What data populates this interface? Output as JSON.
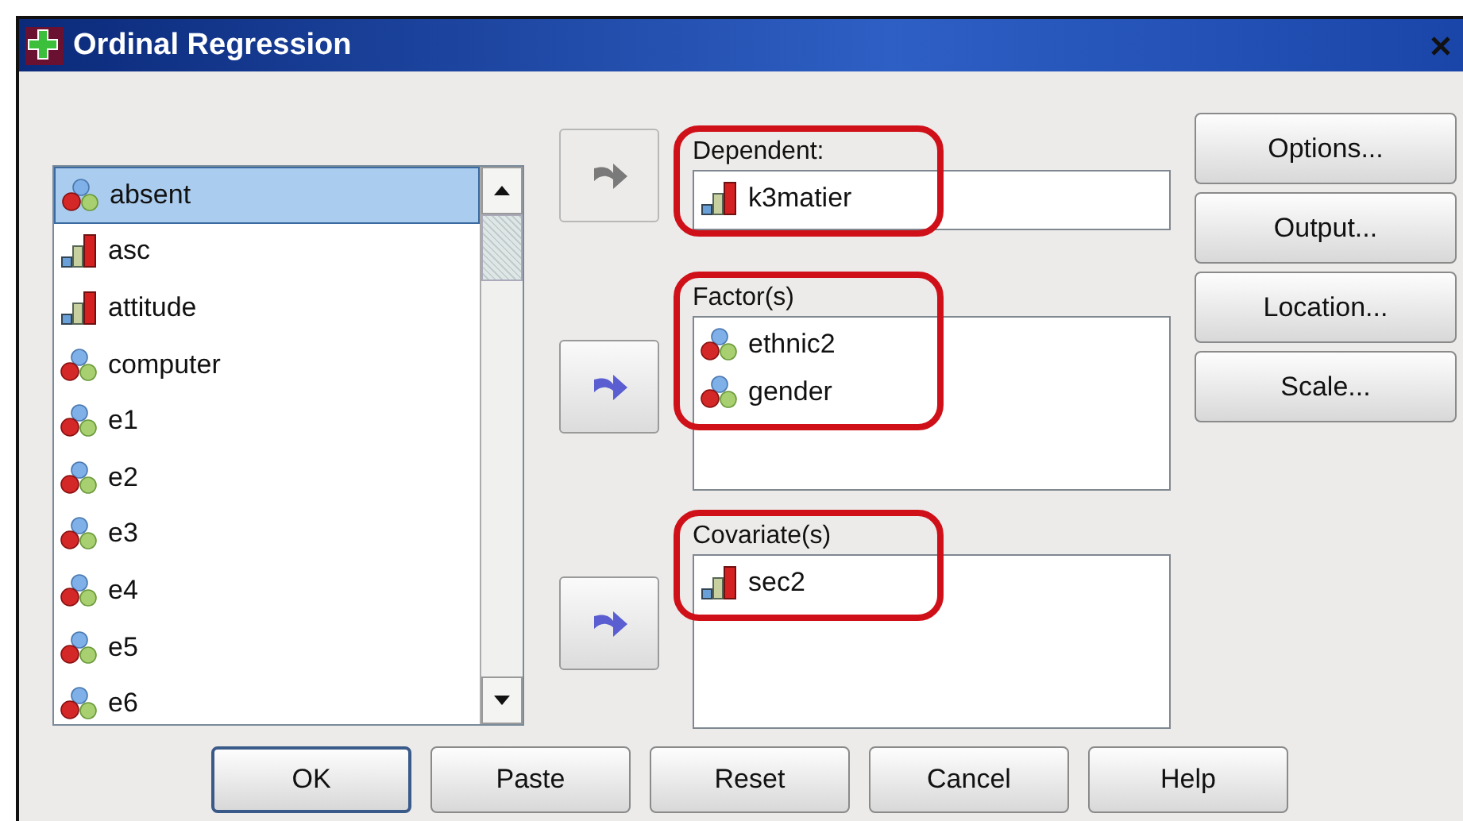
{
  "window": {
    "title": "Ordinal Regression"
  },
  "variables": [
    {
      "name": "absent",
      "kind": "nominal",
      "selected": true
    },
    {
      "name": "asc",
      "kind": "scale",
      "selected": false
    },
    {
      "name": "attitude",
      "kind": "scale",
      "selected": false
    },
    {
      "name": "computer",
      "kind": "nominal",
      "selected": false
    },
    {
      "name": "e1",
      "kind": "nominal",
      "selected": false
    },
    {
      "name": "e2",
      "kind": "nominal",
      "selected": false
    },
    {
      "name": "e3",
      "kind": "nominal",
      "selected": false
    },
    {
      "name": "e4",
      "kind": "nominal",
      "selected": false
    },
    {
      "name": "e5",
      "kind": "nominal",
      "selected": false
    },
    {
      "name": "e6",
      "kind": "nominal",
      "selected": false
    }
  ],
  "targets": [
    {
      "label": "Dependent:",
      "kind": "field",
      "highlighted": true,
      "arrow_disabled": true,
      "items": [
        {
          "name": "k3matier",
          "kind": "scale"
        }
      ]
    },
    {
      "label": "Factor(s)",
      "kind": "list",
      "highlighted": true,
      "arrow_disabled": false,
      "items": [
        {
          "name": "ethnic2",
          "kind": "nominal"
        },
        {
          "name": "gender",
          "kind": "nominal"
        }
      ]
    },
    {
      "label": "Covariate(s)",
      "kind": "list",
      "highlighted": true,
      "arrow_disabled": false,
      "items": [
        {
          "name": "sec2",
          "kind": "scale"
        }
      ]
    }
  ],
  "side_buttons": [
    "Options...",
    "Output...",
    "Location...",
    "Scale..."
  ],
  "buttons": [
    {
      "label": "OK",
      "default": true
    },
    {
      "label": "Paste",
      "default": false
    },
    {
      "label": "Reset",
      "default": false
    },
    {
      "label": "Cancel",
      "default": false
    },
    {
      "label": "Help",
      "default": false
    }
  ]
}
